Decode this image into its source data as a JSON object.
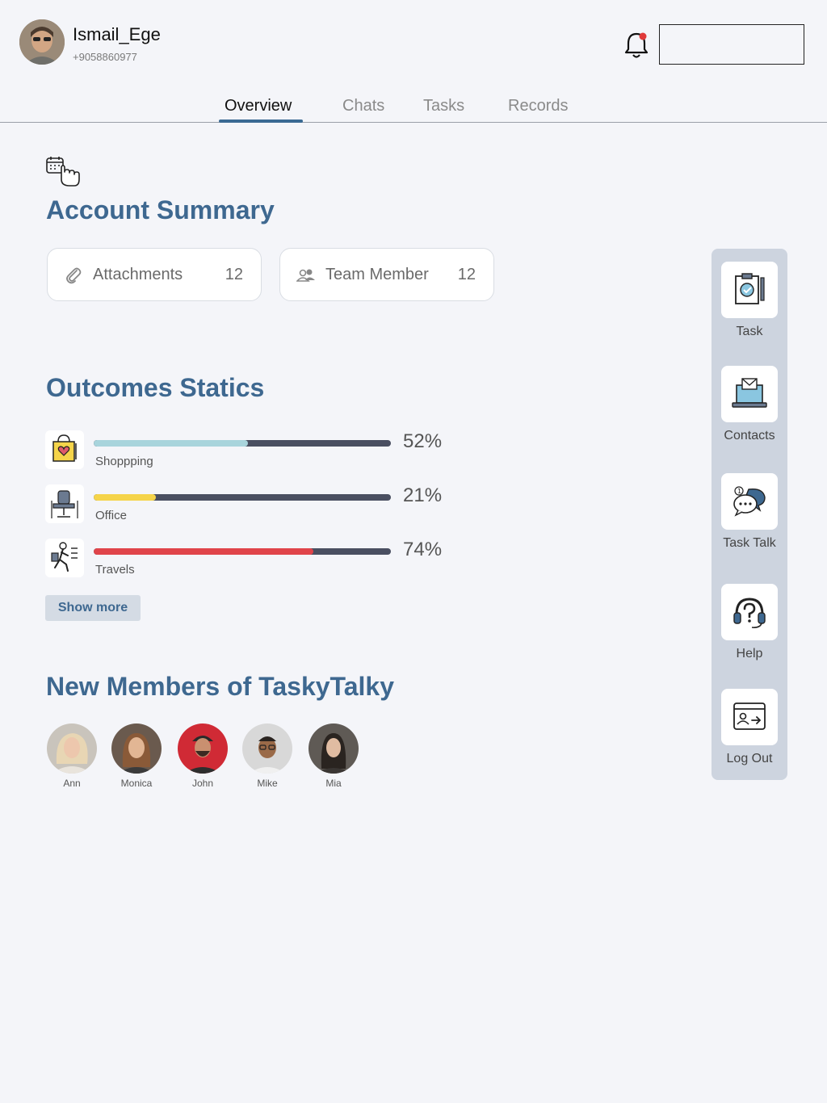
{
  "user": {
    "name": "Ismail_Ege",
    "phone": "+9058860977"
  },
  "tabs": [
    {
      "label": "Overview",
      "active": true
    },
    {
      "label": "Chats",
      "active": false
    },
    {
      "label": "Tasks",
      "active": false
    },
    {
      "label": "Records",
      "active": false
    }
  ],
  "account_summary": {
    "title": "Account Summary",
    "cards": [
      {
        "label": "Attachments",
        "count": "12",
        "icon": "paperclip-icon"
      },
      {
        "label": "Team Member",
        "count": "12",
        "icon": "team-icon"
      }
    ]
  },
  "outcomes": {
    "title": "Outcomes Statics",
    "items": [
      {
        "label": "Shoppping",
        "percent_text": "52%",
        "fraction": 0.52,
        "color": "#a8d4dc",
        "icon": "shopping-bag-icon"
      },
      {
        "label": "Office",
        "percent_text": "21%",
        "fraction": 0.21,
        "color": "#f5d44a",
        "icon": "office-chair-icon"
      },
      {
        "label": "Travels",
        "percent_text": "74%",
        "fraction": 0.74,
        "color": "#e0444a",
        "icon": "traveler-icon"
      }
    ],
    "show_more": "Show more"
  },
  "members": {
    "title": "New Members of TaskyTalky",
    "people": [
      {
        "name": "Ann",
        "bg": "#c9c4bc"
      },
      {
        "name": "Monica",
        "bg": "#6a5a4e"
      },
      {
        "name": "John",
        "bg": "#d02a35"
      },
      {
        "name": "Mike",
        "bg": "#d8d8d8"
      },
      {
        "name": "Mia",
        "bg": "#5f5a55"
      }
    ]
  },
  "sidebar": {
    "items": [
      {
        "label": "Task",
        "icon": "clipboard-check-icon"
      },
      {
        "label": "Contacts",
        "icon": "laptop-mail-icon"
      },
      {
        "label": "Task Talk",
        "icon": "chat-bubbles-icon"
      },
      {
        "label": "Help",
        "icon": "headset-help-icon"
      },
      {
        "label": "Log Out",
        "icon": "logout-card-icon"
      }
    ]
  }
}
